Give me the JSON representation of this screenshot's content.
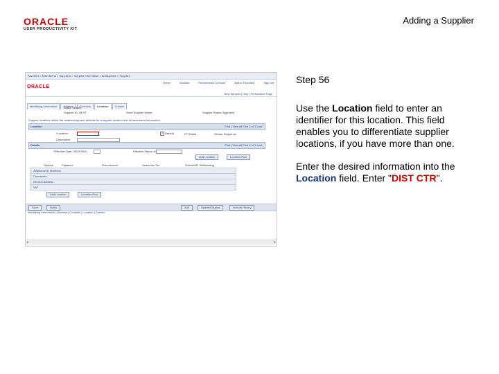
{
  "header": {
    "logo_word": "ORACLE",
    "logo_sub": "USER PRODUCTIVITY KIT",
    "title": "Adding a Supplier"
  },
  "step": {
    "label": "Step 56"
  },
  "instructions": {
    "p1_pre": "Use the ",
    "p1_bold": "Location",
    "p1_post": " field to enter an identifier for this location. This field enables you to differentiate supplier locations, if you have more than one.",
    "p2_pre": "Enter the desired information into the ",
    "p2_field": "Location",
    "p2_mid": " field. Enter \"",
    "p2_value": "DIST CTR",
    "p2_post": "\"."
  },
  "screenshot": {
    "breadcrumb": "Favorites  >  Main Menu  >  Suppliers  >  Supplier Information  >  Add/Update  >  Supplier",
    "oracle": "ORACLE",
    "topnav": [
      "Home",
      "Worklist",
      "Performance Console",
      "Add to Favorites",
      "Sign out"
    ],
    "links": "New Window | Help | Personalize Page",
    "tabs": [
      "Identifying Information",
      "Address",
      "Contacts",
      "Location",
      "Custom"
    ],
    "active_tab": 3,
    "supplier_set_label": "SetID:  SHARE",
    "supplier_id_label": "Supplier ID:  NEXT",
    "short_name_label": "Short Supplier Name:",
    "status_label": "Supplier Status:  Approved",
    "desc": "Supplier locations define the relationships and defaults for a supplier location and its associated information.",
    "location_header": "Location",
    "location_nav": "Find | View All    First  1 of 1  Last",
    "location_label": "*Location:",
    "description_label": "Description:",
    "default_label": "Default",
    "fti_label": "FTI Rules",
    "sequence_label": "Vendor Sequence",
    "address_header": "Details",
    "address_nav": "Find | View All    First  1 of 1  Last",
    "eff_date_label": "*Effective Date:  03/31/2010",
    "eff_status_label": "Effective Status:  Active",
    "add_location_btn": "Add Location",
    "location_row_btn": "Location Row",
    "options_labels": [
      "Options",
      "Payables",
      "Procurement",
      "Sales/Use Tax",
      "Global/VAT Withholding"
    ],
    "sections": [
      "Additional ID Numbers",
      "Comments",
      "Internet Address",
      "VAT"
    ],
    "bottom_buttons": [
      "Save",
      "Notify",
      "Add",
      "Update/Display",
      "Include History"
    ],
    "bottom_links": "Identifying Information | Address | Contacts | Location | Custom"
  }
}
